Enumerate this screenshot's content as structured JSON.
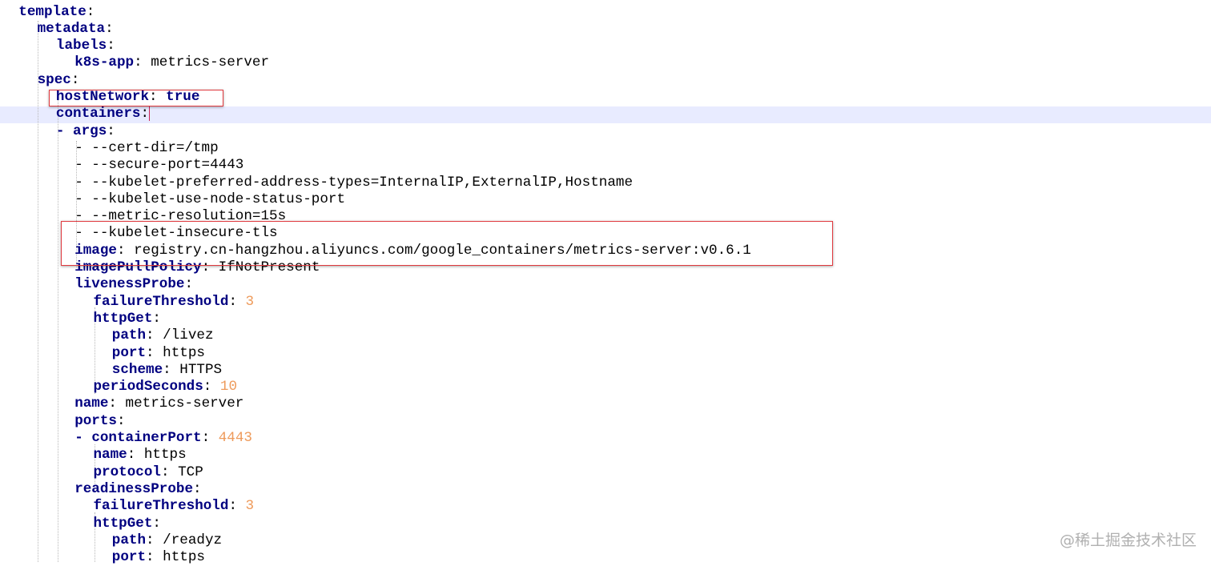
{
  "editor": {
    "lines": [
      {
        "indent": 1,
        "key": "template",
        "colon": ":"
      },
      {
        "indent": 2,
        "key": "metadata",
        "colon": ":"
      },
      {
        "indent": 3,
        "key": "labels",
        "colon": ":"
      },
      {
        "indent": 4,
        "key": "k8s-app",
        "colon": ":",
        "value": " metrics-server",
        "vtype": "s"
      },
      {
        "indent": 2,
        "key": "spec",
        "colon": ":"
      },
      {
        "indent": 3,
        "key": "hostNetwork",
        "colon": ":",
        "value": " true",
        "vtype": "b"
      },
      {
        "indent": 3,
        "key": "containers",
        "colon": ":",
        "caret": true
      },
      {
        "indent": 3,
        "dash": "- ",
        "key": "args",
        "colon": ":"
      },
      {
        "indent": 4,
        "value": "- --cert-dir=/tmp",
        "vtype": "s"
      },
      {
        "indent": 4,
        "value": "- --secure-port=4443",
        "vtype": "s"
      },
      {
        "indent": 4,
        "value": "- --kubelet-preferred-address-types=InternalIP,ExternalIP,Hostname",
        "vtype": "s"
      },
      {
        "indent": 4,
        "value": "- --kubelet-use-node-status-port",
        "vtype": "s"
      },
      {
        "indent": 4,
        "value": "- --metric-resolution=15s",
        "vtype": "s"
      },
      {
        "indent": 4,
        "value": "- --kubelet-insecure-tls",
        "vtype": "s"
      },
      {
        "indent": 4,
        "key": "image",
        "colon": ":",
        "value": " registry.cn-hangzhou.aliyuncs.com/google_containers/metrics-server:v0.6.1",
        "vtype": "s"
      },
      {
        "indent": 4,
        "key": "imagePullPolicy",
        "colon": ":",
        "value": " IfNotPresent",
        "vtype": "s"
      },
      {
        "indent": 4,
        "key": "livenessProbe",
        "colon": ":"
      },
      {
        "indent": 5,
        "key": "failureThreshold",
        "colon": ":",
        "value": " 3",
        "vtype": "n"
      },
      {
        "indent": 5,
        "key": "httpGet",
        "colon": ":"
      },
      {
        "indent": 6,
        "key": "path",
        "colon": ":",
        "value": " /livez",
        "vtype": "s"
      },
      {
        "indent": 6,
        "key": "port",
        "colon": ":",
        "value": " https",
        "vtype": "s"
      },
      {
        "indent": 6,
        "key": "scheme",
        "colon": ":",
        "value": " HTTPS",
        "vtype": "s"
      },
      {
        "indent": 5,
        "key": "periodSeconds",
        "colon": ":",
        "value": " 10",
        "vtype": "n"
      },
      {
        "indent": 4,
        "key": "name",
        "colon": ":",
        "value": " metrics-server",
        "vtype": "s"
      },
      {
        "indent": 4,
        "key": "ports",
        "colon": ":"
      },
      {
        "indent": 4,
        "dash": "- ",
        "key": "containerPort",
        "colon": ":",
        "value": " 4443",
        "vtype": "n"
      },
      {
        "indent": 5,
        "key": "name",
        "colon": ":",
        "value": " https",
        "vtype": "s"
      },
      {
        "indent": 5,
        "key": "protocol",
        "colon": ":",
        "value": " TCP",
        "vtype": "s"
      },
      {
        "indent": 4,
        "key": "readinessProbe",
        "colon": ":"
      },
      {
        "indent": 5,
        "key": "failureThreshold",
        "colon": ":",
        "value": " 3",
        "vtype": "n"
      },
      {
        "indent": 5,
        "key": "httpGet",
        "colon": ":"
      },
      {
        "indent": 6,
        "key": "path",
        "colon": ":",
        "value": " /readyz",
        "vtype": "s"
      },
      {
        "indent": 6,
        "key": "port",
        "colon": ":",
        "value": " https",
        "vtype": "s"
      }
    ]
  },
  "watermark": "@稀土掘金技术社区",
  "colors": {
    "key": "#000080",
    "number": "#ee9a5a",
    "highlight_box": "#e0393e",
    "current_line": "#e8ebff",
    "caret": "#cc2255"
  }
}
